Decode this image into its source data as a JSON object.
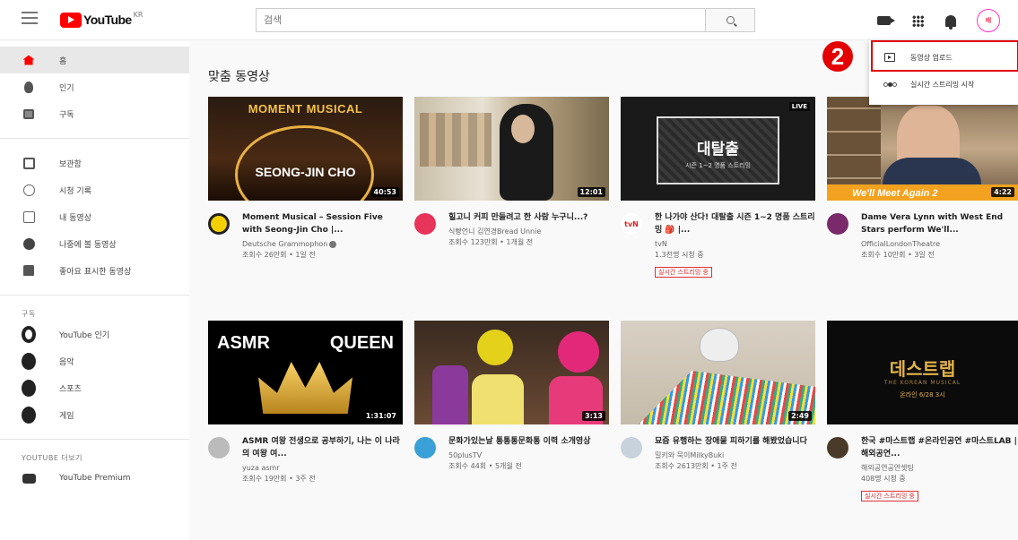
{
  "header": {
    "logo_text": "YouTube",
    "logo_region": "KR",
    "search_placeholder": "검색",
    "avatar_text": "배"
  },
  "sidebar": {
    "main_items": [
      {
        "label": "홈",
        "icon": "home-icon",
        "active": true
      },
      {
        "label": "인기",
        "icon": "trending-icon"
      },
      {
        "label": "구독",
        "icon": "subscriptions-icon"
      }
    ],
    "library_items": [
      {
        "label": "보관함",
        "icon": "library-icon"
      },
      {
        "label": "시청 기록",
        "icon": "history-icon"
      },
      {
        "label": "내 동영상",
        "icon": "your-videos-icon"
      },
      {
        "label": "나중에 볼 동영상",
        "icon": "watch-later-icon"
      },
      {
        "label": "좋아요 표시한 동영상",
        "icon": "liked-videos-icon"
      }
    ],
    "subscriptions_title": "구독",
    "subscriptions": [
      {
        "label": "YouTube 인기",
        "icon": "youtube-popular-icon"
      },
      {
        "label": "음악",
        "icon": "music-icon"
      },
      {
        "label": "스포츠",
        "icon": "sports-icon"
      },
      {
        "label": "게임",
        "icon": "gaming-icon"
      }
    ],
    "more_title": "YOUTUBE 더보기",
    "more_items": [
      {
        "label": "YouTube Premium",
        "icon": "youtube-premium-icon"
      }
    ]
  },
  "main": {
    "section_title": "맞춤 동영상",
    "videos": [
      {
        "thumb_text_1": "MOMENT MUSICAL",
        "thumb_text_2": "SEONG-JIN CHO",
        "duration": "40:53",
        "title": "Moment Musical – Session Five with Seong-Jin Cho |...",
        "channel": "Deutsche Grammophon",
        "stats": "조회수 26만회 • 1일 전",
        "avatar_color": "#f5d000"
      },
      {
        "duration": "12:01",
        "title": "힐고니 커피 만들려고 한 사람 누구니...?",
        "channel": "식빵언니 김연경Bread Unnie",
        "stats": "조회수 123만회 • 1개월 전",
        "avatar_color": "#e8335a"
      },
      {
        "live": "LIVE",
        "thumb_text_1": "대탈출",
        "thumb_text_2": "시즌 1~2 명품 스트리밍",
        "title": "한 나가야 산다! 대탈출 시즌 1~2 명품 스트리밍 🎒 |...",
        "channel": "tvN",
        "stats": "1.3천명 시청 중",
        "badge": "실시간 스트리밍 중",
        "avatar_color": "#e52020"
      },
      {
        "thumb_text_1": "We'll Meet Again 2",
        "duration": "4:22",
        "title": "Dame Vera Lynn with West End Stars perform We'll...",
        "channel": "OfficialLondonTheatre",
        "stats": "조회수 10만회 • 3일 전",
        "avatar_color": "#7a2a6a"
      },
      {
        "thumb_text_1": "ASMR",
        "thumb_text_2": "QUEEN",
        "duration": "1:31:07",
        "title": "ASMR 여왕 전생으로 공부하기, 나는 이 나라의 여왕 여...",
        "channel": "yuza asmr",
        "stats": "조회수 19만회 • 3주 전",
        "avatar_color": "#bbbbbb"
      },
      {
        "duration": "3:13",
        "title": "문화가있는날 통통통문화통 이력 소개영상",
        "channel": "50plusTV",
        "stats": "조회수 44회 • 5개월 전",
        "avatar_color": "#3aa0d8"
      },
      {
        "duration": "2:49",
        "title": "묘즘 유행하는 장애물 피하기를 해봤었습니다",
        "channel": "밀키와 묵이MilkyBuki",
        "stats": "조회수 2613만회 • 1주 전",
        "avatar_color": "#c8d2dc"
      },
      {
        "thumb_text_1": "데스트랩",
        "thumb_text_2": "THE KOREAN MUSICAL",
        "thumb_text_3": "온라인 6/28 3시",
        "title": "한국 #마스트랩 #온라인공연 #마스트LAB | 해외공연...",
        "channel": "해외공연공연셋팅",
        "stats": "408명 시청 중",
        "badge": "실시간 스트리밍 중",
        "avatar_color": "#4a3a2a"
      }
    ]
  },
  "dropdown": {
    "items": [
      {
        "label": "동영상 업로드",
        "icon": "upload-video-icon"
      },
      {
        "label": "실시간 스트리밍 시작",
        "icon": "go-live-icon"
      }
    ]
  },
  "annotation": {
    "step_number": "2",
    "color": "#e30000"
  }
}
